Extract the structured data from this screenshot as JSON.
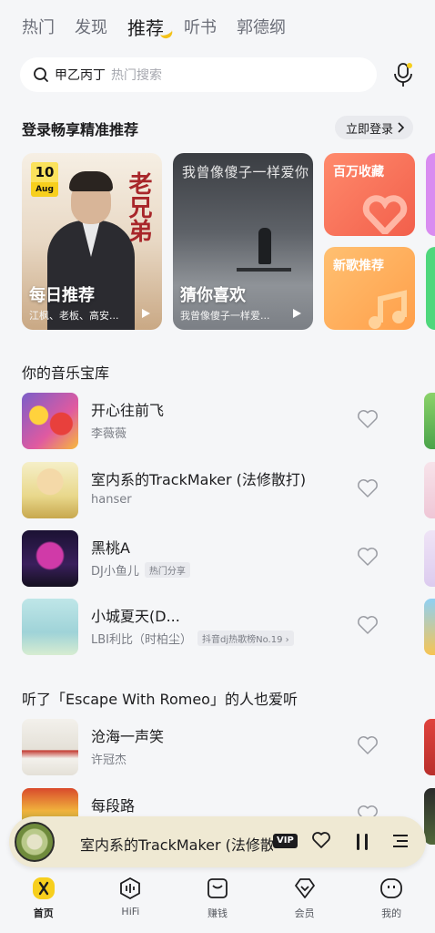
{
  "top_tabs": [
    {
      "label": "热门",
      "active": false
    },
    {
      "label": "发现",
      "active": false
    },
    {
      "label": "推荐",
      "active": true
    },
    {
      "label": "听书",
      "active": false
    },
    {
      "label": "郭德纲",
      "active": false
    }
  ],
  "search": {
    "query": "甲乙丙丁",
    "hint": "热门搜索",
    "icon": "search-icon",
    "voice_icon": "voice-search-icon"
  },
  "recommend": {
    "title": "登录畅享精准推荐",
    "login_label": "立即登录",
    "daily": {
      "title": "每日推荐",
      "subtitle": "江枫、老板、高安...",
      "date_day": "10",
      "date_month": "Aug",
      "art_text": "老兄弟"
    },
    "guess": {
      "title": "猜你喜欢",
      "subtitle": "我曾像傻子一样爱...",
      "art_text": "我曾像傻子一样爱你"
    },
    "small_cards": [
      {
        "label": "百万收藏"
      },
      {
        "label": "新歌推荐"
      }
    ]
  },
  "library": {
    "title": "你的音乐宝库",
    "songs": [
      {
        "title": "开心往前飞",
        "artist": "李薇薇",
        "tag": ""
      },
      {
        "title": "室内系的TrackMaker (法修散打)",
        "artist": "hanser",
        "tag": ""
      },
      {
        "title": "黑桃A",
        "artist": "DJ小鱼儿",
        "tag": "热门分享"
      },
      {
        "title": "小城夏天(D...",
        "artist": "LBI利比（时柏尘）",
        "tag": "抖音dj热歌榜No.19"
      }
    ]
  },
  "also_like": {
    "title": "听了「Escape With Romeo」的人也爱听",
    "songs": [
      {
        "title": "沧海一声笑",
        "artist": "许冠杰"
      },
      {
        "title": "每段路",
        "artist": ""
      }
    ]
  },
  "player": {
    "title": "室内系的TrackMaker (法修散",
    "vip": "VIP"
  },
  "bottom_nav": [
    {
      "label": "首页",
      "icon": "home-icon",
      "active": true
    },
    {
      "label": "HiFi",
      "icon": "hifi-icon",
      "active": false
    },
    {
      "label": "赚钱",
      "icon": "earn-icon",
      "active": false
    },
    {
      "label": "会员",
      "icon": "vip-icon",
      "active": false
    },
    {
      "label": "我的",
      "icon": "profile-icon",
      "active": false
    }
  ],
  "colors": {
    "accent": "#f7cf1d",
    "background": "#f5f6f8",
    "player_bg": "#efe9d3"
  }
}
